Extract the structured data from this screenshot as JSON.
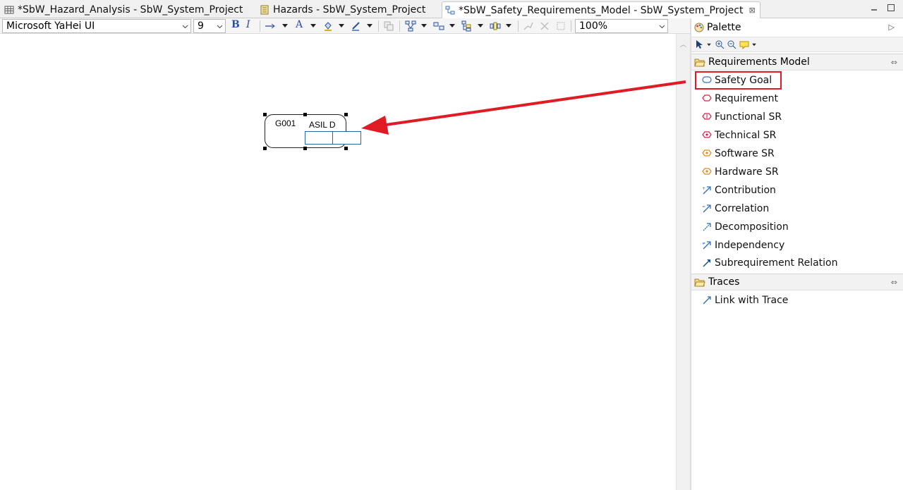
{
  "tabs": [
    {
      "label": "*SbW_Hazard_Analysis - SbW_System_Project",
      "icon": "table-icon"
    },
    {
      "label": "Hazards - SbW_System_Project",
      "icon": "document-icon"
    },
    {
      "label": "*SbW_Safety_Requirements_Model - SbW_System_Project",
      "icon": "diagram-icon",
      "active": true
    }
  ],
  "toolbar": {
    "font_name": "Microsoft YaHei UI",
    "font_size": "9",
    "bold": "B",
    "italic": "I",
    "font_color": "A",
    "zoom": "100%"
  },
  "diagram": {
    "node": {
      "id": "G001",
      "asil": "ASIL D"
    }
  },
  "palette": {
    "title": "Palette",
    "groups": [
      {
        "label": "Requirements Model",
        "items": [
          {
            "label": "Safety Goal",
            "icon": "safety-goal-icon",
            "color": "#3b6fb6"
          },
          {
            "label": "Requirement",
            "icon": "requirement-icon",
            "color": "#d6204d"
          },
          {
            "label": "Functional SR",
            "icon": "functional-sr-icon",
            "color": "#d6204d"
          },
          {
            "label": "Technical SR",
            "icon": "technical-sr-icon",
            "color": "#d6204d"
          },
          {
            "label": "Software SR",
            "icon": "software-sr-icon",
            "color": "#e08a1e"
          },
          {
            "label": "Hardware SR",
            "icon": "hardware-sr-icon",
            "color": "#e08a1e"
          },
          {
            "label": "Contribution",
            "icon": "contribution-icon",
            "color": "#2f6fb0"
          },
          {
            "label": "Correlation",
            "icon": "correlation-icon",
            "color": "#2f6fb0"
          },
          {
            "label": "Decomposition",
            "icon": "decomposition-icon",
            "color": "#2f6fb0"
          },
          {
            "label": "Independency",
            "icon": "independency-icon",
            "color": "#2f6fb0"
          },
          {
            "label": "Subrequirement Relation",
            "icon": "subrequirement-icon",
            "color": "#2f6fb0"
          }
        ]
      },
      {
        "label": "Traces",
        "items": [
          {
            "label": "Link with Trace",
            "icon": "trace-link-icon",
            "color": "#2f6fb0"
          }
        ]
      }
    ]
  },
  "annotation": {
    "highlight_color": "#e01b24",
    "arrow_color": "#e01b24"
  }
}
